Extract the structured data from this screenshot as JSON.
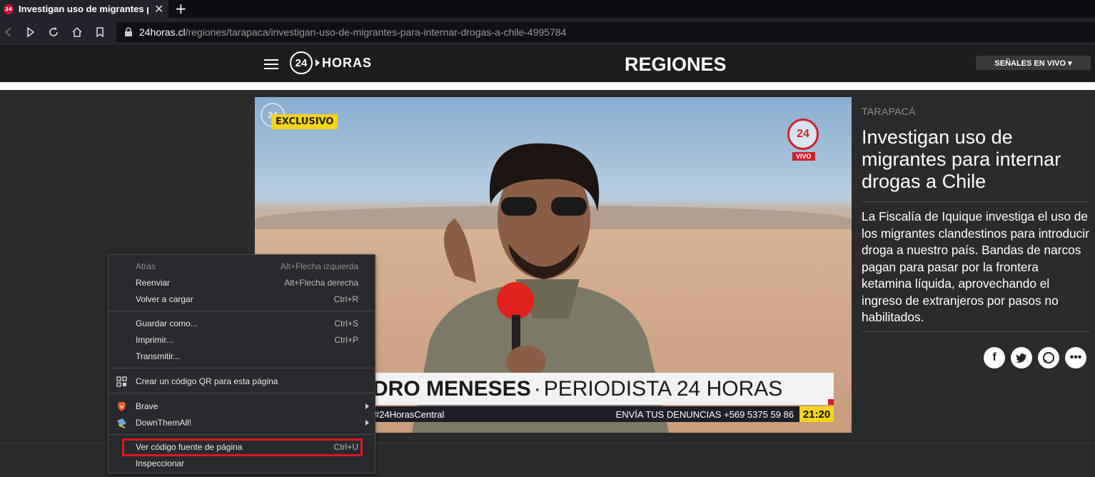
{
  "browser": {
    "tab_title": "Investigan uso de migrantes para internar drogas a Chile",
    "tab_favicon_text": "24",
    "url_host": "24horas.cl",
    "url_path": "/regiones/tarapaca/investigan-uso-de-migrantes-para-internar-drogas-a-chile-4995784"
  },
  "site": {
    "logo_number": "24",
    "logo_text": "HORAS",
    "section": "REGIONES",
    "live_button": "SEÑALES EN VIVO ▾"
  },
  "video": {
    "badge": "EXCLUSIVO",
    "watermark": "24",
    "live_logo": "24",
    "live_label": "VIVO",
    "lower_third_name": "DRO MENESES",
    "lower_third_sep": "·",
    "lower_third_role": "PERIODISTA 24 HORAS",
    "ticker_hashtag": "#24HorasCentral",
    "ticker_denuncias": "ENVÍA TUS DENUNCIAS +569 5375 59 86",
    "ticker_time": "21:20"
  },
  "article": {
    "kicker": "TARAPACÁ",
    "headline": "Investigan uso de migrantes para internar drogas a Chile",
    "summary": "La Fiscalía de Iquique investiga el uso de los migrantes clandestinos para introducir droga a nuestro país. Bandas de narcos pagan para pasar por la frontera ketamina líquida, aprovechando el ingreso de extranjeros por pasos no habilitados.",
    "share_icons": [
      "facebook-icon",
      "twitter-icon",
      "whatsapp-icon",
      "more-icon"
    ]
  },
  "context_menu": {
    "items": [
      {
        "label": "Atrás",
        "shortcut": "Alt+Flecha izquierda",
        "disabled": true
      },
      {
        "label": "Reenviar",
        "shortcut": "Alt+Flecha derecha"
      },
      {
        "label": "Volver a cargar",
        "shortcut": "Ctrl+R"
      },
      {
        "label": "Guardar como...",
        "shortcut": "Ctrl+S"
      },
      {
        "label": "Imprimir...",
        "shortcut": "Ctrl+P"
      },
      {
        "label": "Transmitir..."
      },
      {
        "label": "Crear un código QR para esta página",
        "icon": "qr-code-icon"
      },
      {
        "label": "Brave",
        "icon": "brave-icon",
        "submenu": true
      },
      {
        "label": "DownThemAll!",
        "icon": "downthemall-icon",
        "submenu": true
      },
      {
        "label": "Ver código fuente de página",
        "shortcut": "Ctrl+U",
        "highlighted": true
      },
      {
        "label": "Inspeccionar"
      }
    ],
    "highlight_color": "#e0161e"
  }
}
